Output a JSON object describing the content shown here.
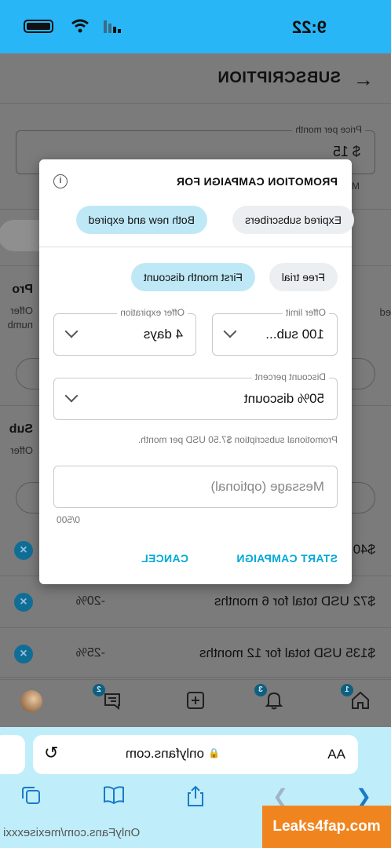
{
  "status_bar": {
    "time": "9:22"
  },
  "header": {
    "title": "SUBSCRIPTION",
    "back_icon": "arrow-back-icon"
  },
  "price": {
    "label": "Price per month",
    "value": "$ 15",
    "note": "M"
  },
  "background": {
    "promo_title": "Pro",
    "promo_sub1": "Offer",
    "promo_sub2": "numb",
    "promo_right": "ed",
    "bundle_title": "Sub",
    "bundle_sub": "Offer",
    "bundles": [
      {
        "text": "$40",
        "percent": ""
      },
      {
        "text": "$72 USD total for 6 months",
        "percent": "-20%"
      },
      {
        "text": "$135 USD total for 12 months",
        "percent": "-25%"
      }
    ]
  },
  "bottom_nav": {
    "home_badge": "1",
    "notifications_badge": "3",
    "messages_badge": "2"
  },
  "modal": {
    "title": "PROMOTION CAMPAIGN FOR",
    "audience_chips": [
      "Expired subscribers",
      "Both new and expired"
    ],
    "type_chips": [
      "Free trial",
      "First month discount"
    ],
    "offer_limit": {
      "label": "Offer limit",
      "value": "100 sub..."
    },
    "offer_expiration": {
      "label": "Offer expiration",
      "value": "4 days"
    },
    "discount_percent": {
      "label": "Discount percent",
      "value": "50% discount"
    },
    "note": "Promotional subscription $7.50 USD per month.",
    "message_placeholder": "Message (optional)",
    "char_count": "0/500",
    "cancel_label": "CANCEL",
    "start_label": "START CAMPAIGN"
  },
  "safari": {
    "text_size_label": "AA",
    "url": "onlyfans.com"
  },
  "watermarks": {
    "left": "OnlyFans.com/mexisexxxi",
    "right": "Leaks4fap.com"
  }
}
